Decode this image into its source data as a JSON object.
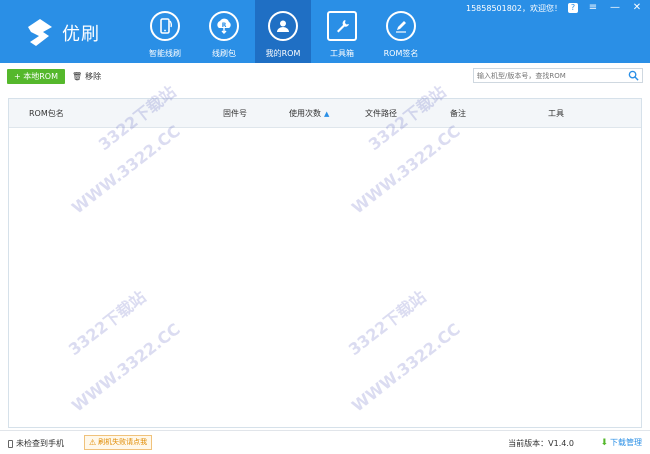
{
  "app": {
    "name": "优刷",
    "welcome": "15858501802，欢迎您！"
  },
  "window": {
    "help": "?",
    "menu": "≡",
    "minimize": "—",
    "close": "✕"
  },
  "nav": {
    "items": [
      {
        "label": "智能线刷",
        "icon": "smart-flash-icon"
      },
      {
        "label": "线刷包",
        "icon": "flash-package-icon"
      },
      {
        "label": "我的ROM",
        "icon": "my-rom-icon"
      },
      {
        "label": "工具箱",
        "icon": "toolbox-icon"
      },
      {
        "label": "ROM签名",
        "icon": "rom-sign-icon"
      }
    ],
    "active": "我的ROM"
  },
  "toolbar": {
    "add_label": "+ 本地ROM",
    "remove_label": "移除",
    "search_placeholder": "输入机型/版本号，查找ROM"
  },
  "table": {
    "columns": [
      "ROM包名",
      "固件号",
      "使用次数",
      "文件路径",
      "备注",
      "工具"
    ],
    "rows": []
  },
  "status": {
    "phone": "未检查到手机",
    "warning": "刷机失败请点我",
    "version": "当前版本：V1.4.0",
    "download": "下载管理"
  },
  "watermark": {
    "text1": "3322下载站",
    "text2": "WWW.3322.CC"
  },
  "colors": {
    "header": "#2a8fe6",
    "header_active": "#1f6fc4",
    "green": "#55b82c",
    "warning": "#e08a00"
  }
}
